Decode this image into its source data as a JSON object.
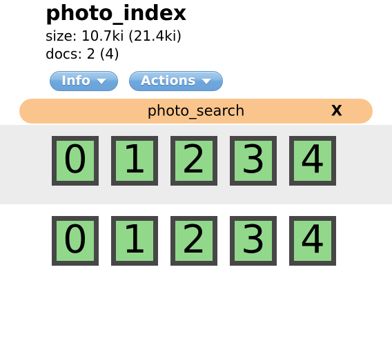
{
  "header": {
    "title": "photo_index",
    "size_line": "size: 10.7ki (21.4ki)",
    "docs_line": "docs: 2 (4)"
  },
  "toolbar": {
    "buttons": [
      {
        "label": "Info",
        "icon": "chevron-down-icon"
      },
      {
        "label": "Actions",
        "icon": "chevron-down-icon"
      }
    ]
  },
  "search_bar": {
    "label": "photo_search",
    "close_label": "X",
    "color": "#fac58c"
  },
  "tiles": {
    "tile_color": "#92d88b",
    "border_color": "#474747",
    "band_color": "#ececec",
    "rows": [
      {
        "name": "row-shaded",
        "digits": [
          "0",
          "1",
          "2",
          "3",
          "4"
        ]
      },
      {
        "name": "row-plain",
        "digits": [
          "0",
          "1",
          "2",
          "3",
          "4"
        ]
      }
    ]
  }
}
